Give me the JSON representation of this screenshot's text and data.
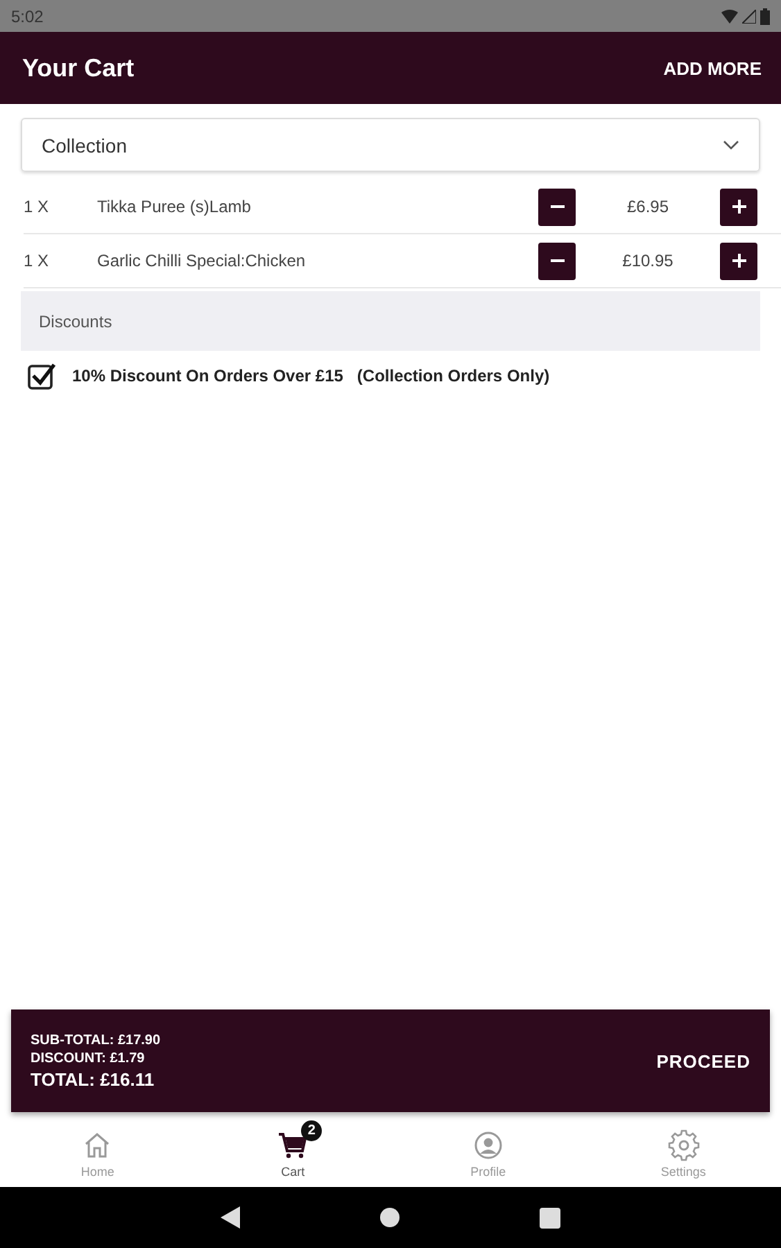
{
  "status_bar": {
    "time": "5:02"
  },
  "header": {
    "title": "Your Cart",
    "action": "ADD MORE"
  },
  "order_type": {
    "value": "Collection"
  },
  "items": [
    {
      "quantity": "1 X",
      "name": "Tikka Puree (s)Lamb",
      "price": "£6.95"
    },
    {
      "quantity": "1 X",
      "name": "Garlic Chilli Special:Chicken",
      "price": "£10.95"
    }
  ],
  "discounts": {
    "heading": "Discounts",
    "options": [
      {
        "label": "10% Discount On Orders Over £15",
        "note": "(Collection Orders Only)",
        "checked": true
      }
    ]
  },
  "summary": {
    "subtotal": "SUB-TOTAL: £17.90",
    "discount": "DISCOUNT: £1.79",
    "total": "TOTAL: £16.11",
    "action": "PROCEED"
  },
  "bottom_nav": [
    {
      "kind": "home",
      "label": "Home",
      "selected": false
    },
    {
      "kind": "cart",
      "label": "Cart",
      "selected": true,
      "badge": "2"
    },
    {
      "kind": "profile",
      "label": "Profile",
      "selected": false
    },
    {
      "kind": "settings",
      "label": "Settings",
      "selected": false
    }
  ]
}
